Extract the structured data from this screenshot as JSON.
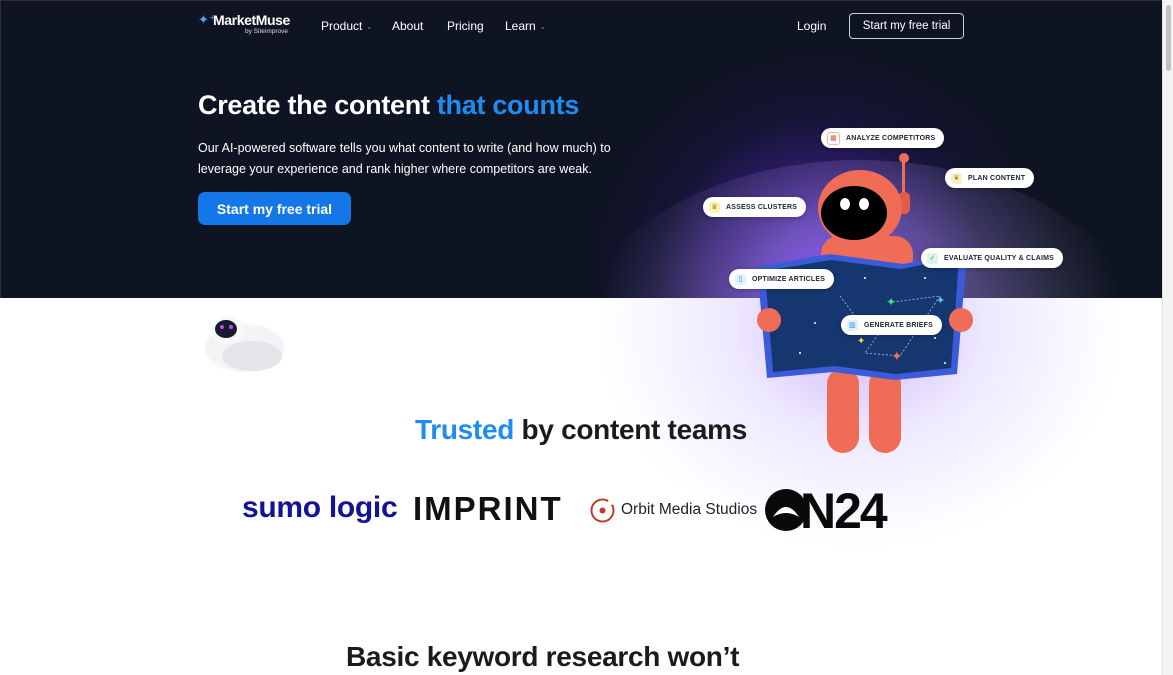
{
  "nav": {
    "logo_name": "MarketMuse",
    "logo_sub": "by Siteimprove",
    "links": [
      {
        "label": "Product",
        "has_dropdown": true
      },
      {
        "label": "About",
        "has_dropdown": false
      },
      {
        "label": "Pricing",
        "has_dropdown": false
      },
      {
        "label": "Learn",
        "has_dropdown": true
      }
    ],
    "login_label": "Login",
    "cta_label": "Start my free trial"
  },
  "hero": {
    "title_main": "Create the content ",
    "title_accent": "that counts",
    "description": "Our AI-powered software tells you what content to write (and how much) to leverage your experience and rank higher where competitors are weak.",
    "cta_label": "Start my free trial"
  },
  "chips": {
    "analyze": "ANALYZE COMPETITORS",
    "plan": "PLAN CONTENT",
    "assess": "ASSESS CLUSTERS",
    "evaluate": "EVALUATE QUALITY & CLAIMS",
    "optimize": "OPTIMIZE ARTICLES",
    "briefs": "GENERATE BRIEFS"
  },
  "trusted": {
    "accent": "Trusted",
    "rest": " by content teams"
  },
  "customer_logos": {
    "sumo": "sumo logic",
    "imprint": "IMPRINT",
    "orbit": "Orbit Media Studios",
    "on24": "N24"
  },
  "section_title": "Basic keyword research won’t",
  "colors": {
    "accent": "#1e8cf1",
    "hero_bg": "#0e1421",
    "robot": "#ef6c56",
    "glow": "#7c3cff"
  }
}
